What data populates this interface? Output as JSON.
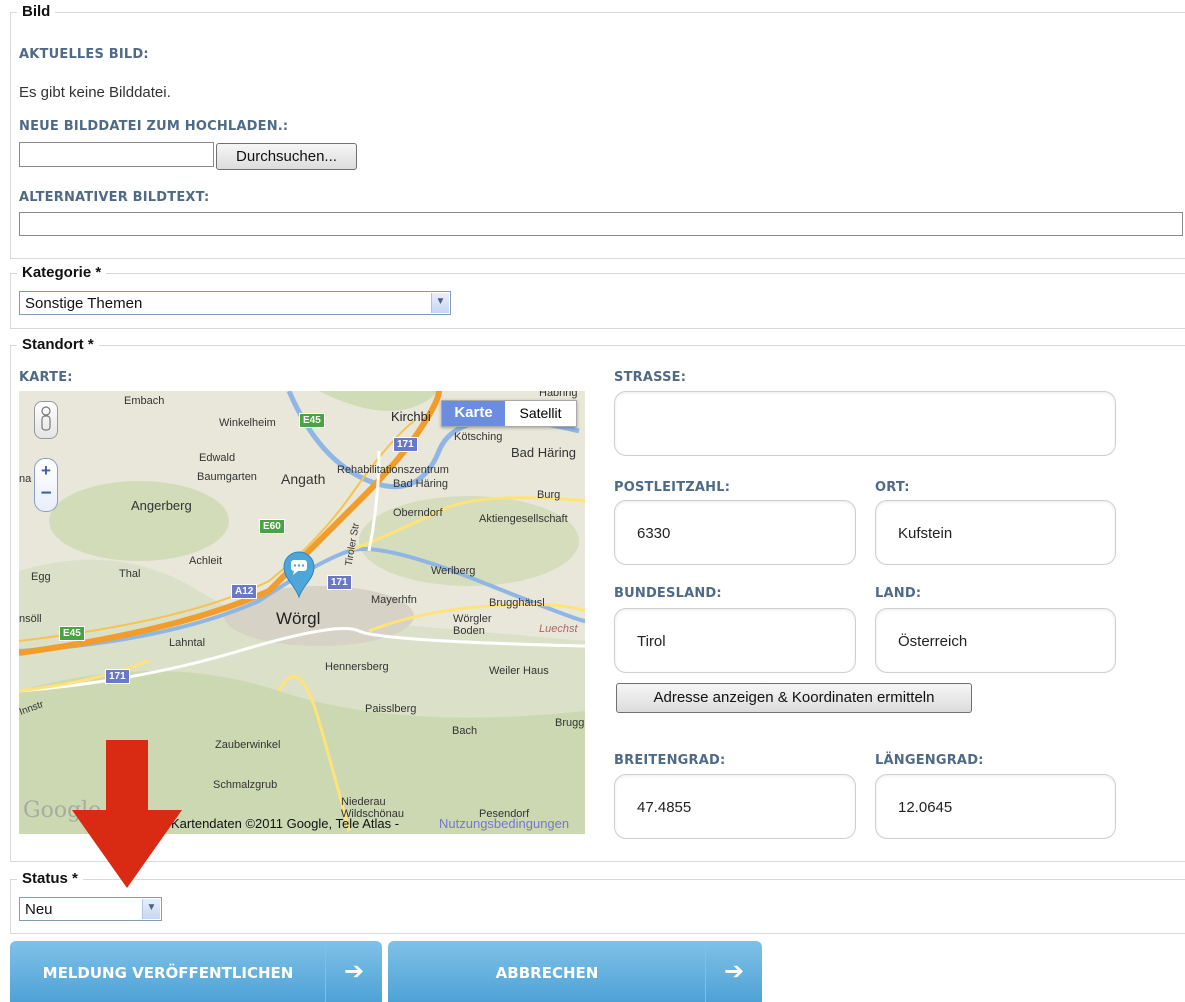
{
  "bild": {
    "legend": "Bild",
    "aktuelles_label": "AKTUELLES BILD:",
    "no_file_text": "Es gibt keine Bilddatei.",
    "upload_label": "NEUE BILDDATEI ZUM HOCHLADEN.:",
    "browse_label": "Durchsuchen...",
    "alt_label": "ALTERNATIVER BILDTEXT:",
    "alt_value": ""
  },
  "kategorie": {
    "legend": "Kategorie *",
    "selected": "Sonstige Themen"
  },
  "standort": {
    "legend": "Standort *",
    "karte_label": "KARTE:",
    "strasse_label": "STRASSE:",
    "strasse_value": "",
    "plz_label": "POSTLEITZAHL:",
    "plz_value": "6330",
    "ort_label": "ORT:",
    "ort_value": "Kufstein",
    "bundesland_label": "BUNDESLAND:",
    "bundesland_value": "Tirol",
    "land_label": "LAND:",
    "land_value": "Österreich",
    "geocode_button": "Adresse anzeigen & Koordinaten ermitteln",
    "breitengrad_label": "BREITENGRAD:",
    "breitengrad_value": "47.4855",
    "laengengrad_label": "LÄNGENGRAD:",
    "laengengrad_value": "12.0645"
  },
  "map": {
    "type_karte": "Karte",
    "type_satellit": "Satellit",
    "city_main": "Wörgl",
    "places": [
      "Embach",
      "Winkelheim",
      "Kirchbi",
      "Kötsching",
      "Edwald",
      "Baumgarten",
      "Angath",
      "Rehabilitationszentrum",
      "Bad Häring",
      "Bad Häring",
      "Burg",
      "Angerberg",
      "Oberndorf",
      "Aktiengesellschaft",
      "Achleit",
      "Egg",
      "Thal",
      "Werlberg",
      "Mayerhfn",
      "Brugghäusl",
      "Wörgler",
      "Boden",
      "Lahntal",
      "Hennersberg",
      "Weiler Haus",
      "Paisslberg",
      "Bach",
      "Zauberwinkel",
      "Schmalzgrub",
      "Niederau",
      "Wildschönau",
      "Pesendorf",
      "Habring",
      "na",
      "nsöll",
      "Brugg",
      "Tiroler Str",
      "Innstr",
      "Luechst"
    ],
    "roads": [
      "E45",
      "171",
      "E60",
      "A12",
      "171",
      "E45",
      "171"
    ],
    "copyright": "Kartendaten ©2011 Google, Tele Atlas -",
    "terms": "Nutzungsbedingungen",
    "google": "Google"
  },
  "status": {
    "legend": "Status *",
    "selected": "Neu"
  },
  "actions": {
    "publish": "MELDUNG VERÖFFENTLICHEN",
    "cancel": "ABBRECHEN",
    "arrow": "➔"
  },
  "colors": {
    "label_blue": "#4f6a87",
    "button_blue": "#55a6d9",
    "annotation_red": "#d92b14"
  }
}
